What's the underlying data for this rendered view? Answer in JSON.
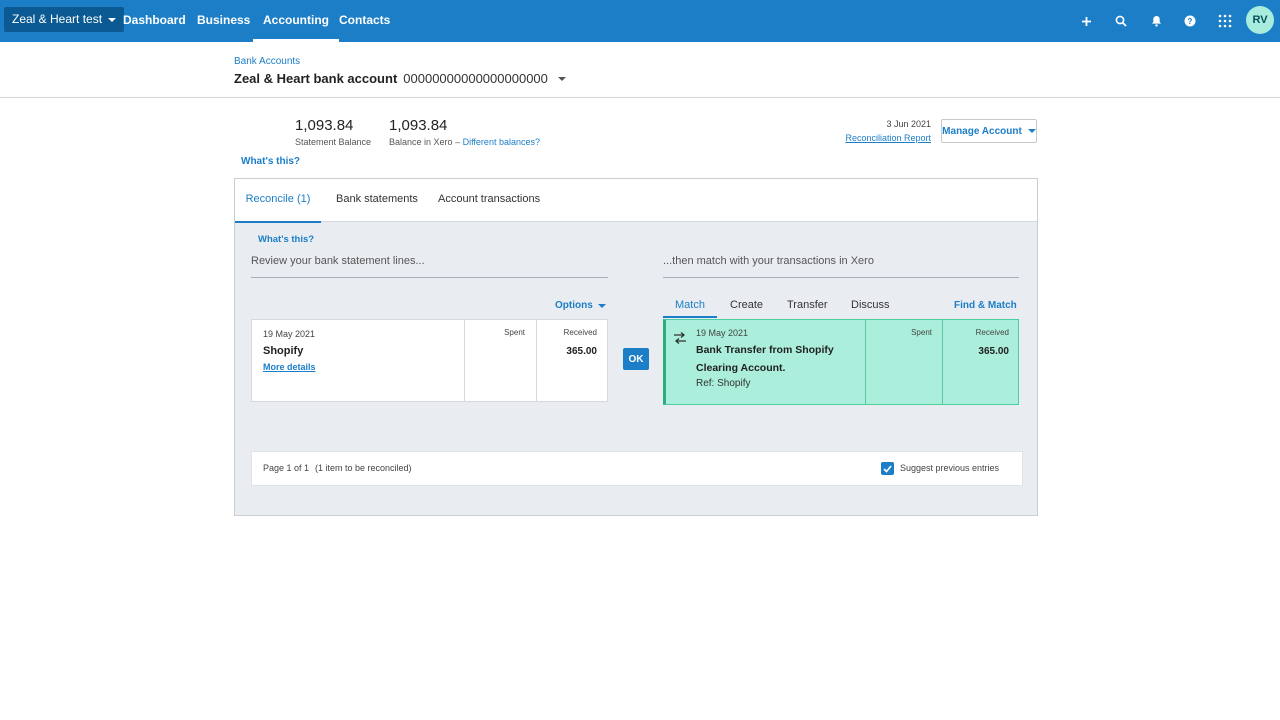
{
  "topnav": {
    "org_name": "Zeal & Heart test",
    "links": [
      "Dashboard",
      "Business",
      "Accounting",
      "Contacts"
    ],
    "avatar_initials": "RV",
    "icons": [
      "plus-icon",
      "search-icon",
      "bell-icon",
      "help-icon",
      "apps-grid-icon"
    ]
  },
  "header": {
    "breadcrumb": "Bank Accounts",
    "account_name": "Zeal & Heart bank account",
    "account_number": "00000000000000000000"
  },
  "balances": {
    "statement_balance": "1,093.84",
    "statement_label": "Statement Balance",
    "xero_balance": "1,093.84",
    "xero_label": "Balance in Xero",
    "separator": "–",
    "different_link": "Different balances?",
    "whats_this": "What's this?",
    "date": "3 Jun 2021",
    "report_link": "Reconciliation Report",
    "manage_button": "Manage Account"
  },
  "tabs": [
    "Reconcile (1)",
    "Bank statements",
    "Account transactions"
  ],
  "reconcile": {
    "whats_this": "What's this?",
    "left_heading": "Review your bank statement lines...",
    "right_heading": "...then match with your transactions in Xero",
    "options": "Options",
    "statement_line": {
      "date": "19 May 2021",
      "payee": "Shopify",
      "more_details": "More details",
      "spent_label": "Spent",
      "received_label": "Received",
      "received": "365.00"
    },
    "ok_button": "OK",
    "match_tabs": [
      "Match",
      "Create",
      "Transfer",
      "Discuss"
    ],
    "find_match": "Find & Match",
    "match_line": {
      "date": "19 May 2021",
      "description_1": "Bank Transfer from Shopify",
      "description_2": "Clearing Account.",
      "ref": "Ref: Shopify",
      "spent_label": "Spent",
      "received_label": "Received",
      "received": "365.00"
    },
    "footer": {
      "page": "Page 1 of 1",
      "items": "(1 item to be reconciled)",
      "suggest_label": "Suggest previous entries",
      "suggest_checked": true
    }
  },
  "colors": {
    "brand_blue": "#1c7ec7",
    "match_green": "#aaeedb",
    "panel_bg": "#e9edf1"
  }
}
